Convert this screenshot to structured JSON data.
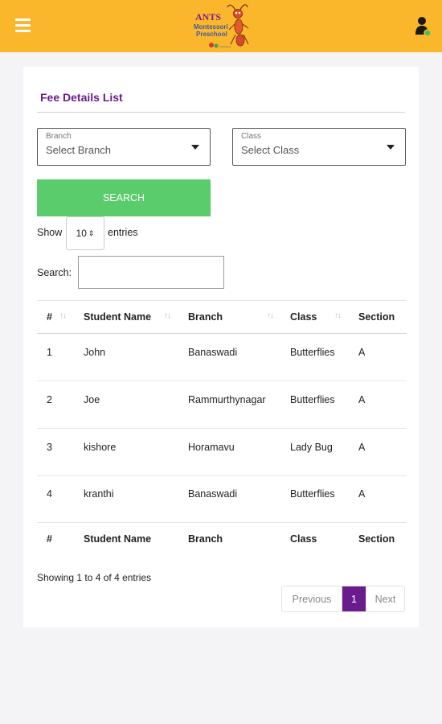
{
  "header": {
    "logo_text": "ANTS Montessori Preschool",
    "menu_icon": "hamburger-menu-icon",
    "user_icon": "user-online-icon",
    "brand_color": "#fbb72b"
  },
  "page": {
    "title": "Fee Details List",
    "accent_color": "#6a1b8c"
  },
  "filters": {
    "branch": {
      "label": "Branch",
      "placeholder": "Select Branch"
    },
    "class": {
      "label": "Class",
      "placeholder": "Select Class"
    },
    "search_button": "SEARCH"
  },
  "table_controls": {
    "show_label": "Show",
    "entries_value": "10",
    "entries_label": "entries",
    "search_label": "Search:"
  },
  "table": {
    "columns": [
      "#",
      "Student Name",
      "Branch",
      "Class",
      "Section"
    ],
    "rows": [
      [
        "1",
        "John",
        "Banaswadi",
        "Butterflies",
        "A"
      ],
      [
        "2",
        "Joe",
        "Rammurthynagar",
        "Butterflies",
        "A"
      ],
      [
        "3",
        "kishore",
        "Horamavu",
        "Lady Bug",
        "A"
      ],
      [
        "4",
        "kranthi",
        "Banaswadi",
        "Butterflies",
        "A"
      ]
    ]
  },
  "pagination": {
    "info": "Showing 1 to 4 of 4 entries",
    "previous": "Previous",
    "current": "1",
    "next": "Next"
  }
}
